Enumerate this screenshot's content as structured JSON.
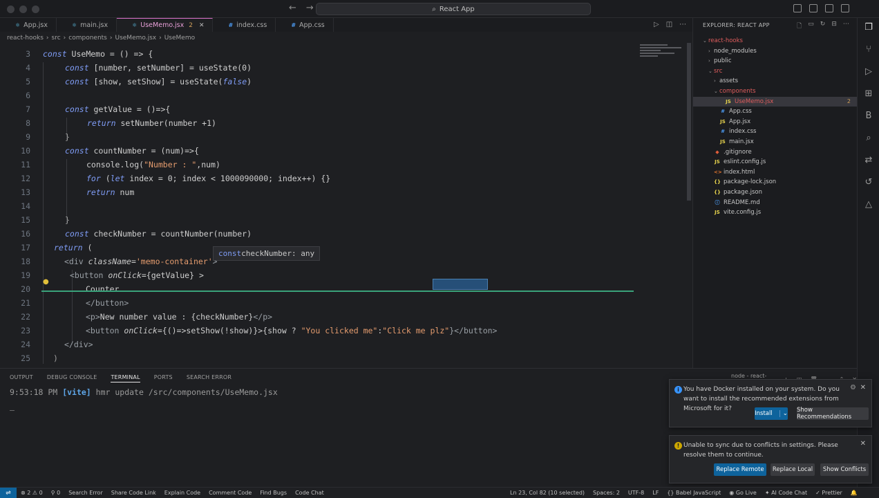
{
  "window": {
    "title": "React App"
  },
  "tabs": [
    {
      "label": "App.jsx",
      "icon": "⚛",
      "color": "#5ec2e8",
      "active": false
    },
    {
      "label": "main.jsx",
      "icon": "⚛",
      "color": "#5ec2e8",
      "active": false
    },
    {
      "label": "UseMemo.jsx",
      "badge": "2",
      "icon": "⚛",
      "color": "#5ec2e8",
      "active": true
    },
    {
      "label": "index.css",
      "icon": "#",
      "color": "#4c9bf2",
      "active": false
    },
    {
      "label": "App.css",
      "icon": "#",
      "color": "#4c9bf2",
      "active": false
    }
  ],
  "breadcrumb": [
    "react-hooks",
    "src",
    "components",
    "UseMemo.jsx",
    "UseMemo"
  ],
  "editor": {
    "line_numbers": [
      "3",
      "4",
      "5",
      "6",
      "7",
      "8",
      "9",
      "10",
      "11",
      "12",
      "13",
      "14",
      "15",
      "16",
      "17",
      "18",
      "19",
      "20",
      "21",
      "22",
      "23",
      "24",
      "25"
    ],
    "l3": {
      "kw": "const",
      "rest": " UseMemo = () => {"
    },
    "l4": {
      "kw": "const",
      "rest": " [number, setNumber] = useState(0)"
    },
    "l5": {
      "kw": "const",
      "rest": " [show, setShow] = useState(",
      "v": "false",
      "end": ")"
    },
    "l7": {
      "kw": "const",
      "rest": " getValue = ()=>{"
    },
    "l8": {
      "kw": "return",
      "rest": " setNumber(number +1)"
    },
    "l9": {
      "rest": "}"
    },
    "l10": {
      "kw": "const",
      "rest": " countNumber = (num)=>{"
    },
    "l11": {
      "a": "console.log(",
      "s": "\"Number : \"",
      "b": ",num)"
    },
    "l12": {
      "kw": "for",
      "a": " (",
      "kw2": "let",
      "b": " index = 0; index < 1000090000; index++) {}"
    },
    "l13": {
      "kw": "return",
      "rest": " num"
    },
    "l15": {
      "rest": "}"
    },
    "l16": {
      "kw": "const",
      "rest": " checkNumber = countNumber(number)"
    },
    "l17": {
      "kw": "return",
      "rest": " ("
    },
    "l18": {
      "a": "<div ",
      "attr": "className",
      "b": "=",
      "s": "'memo-container'",
      "c": ">"
    },
    "l19": {
      "a": "<button ",
      "attr": "onClick",
      "b": "={getValue} >"
    },
    "l20": {
      "rest": "Counter"
    },
    "l21": {
      "rest": "</button>"
    },
    "l22": {
      "a": "<p>",
      "b": "New number value : {checkNumber}",
      "c": "</p>"
    },
    "l23": {
      "a": "<button ",
      "attr": "onClick",
      "b": "={()=>setShow(!show)}>{show ? ",
      "s1": "\"You clicked me\"",
      "c": ":",
      "s2": "\"Click me plz\"",
      "d": "}</button>"
    },
    "l24": {
      "rest": "</div>"
    },
    "l25": {
      "rest": ")"
    },
    "hover": {
      "kw": "const",
      "text": " checkNumber: any"
    }
  },
  "panel": {
    "tabs": [
      "OUTPUT",
      "DEBUG CONSOLE",
      "TERMINAL",
      "PORTS",
      "SEARCH ERROR"
    ],
    "active_tab": "TERMINAL",
    "terminal_name": "node - react-hooks",
    "terminal_time": "9:53:18 PM",
    "terminal_tag": "[vite]",
    "terminal_msg": "hmr update /src/components/UseMemo.jsx",
    "terminal_cursor": "_"
  },
  "notifications": [
    {
      "message": "You have Docker installed on your system. Do you want to install the recommended extensions from Microsoft for it?",
      "buttons": [
        "Install",
        "Show Recommendations"
      ],
      "icon_color": "#3794ff"
    },
    {
      "message": "Unable to sync due to conflicts in settings. Please resolve them to continue.",
      "buttons": [
        "Replace Remote",
        "Replace Local",
        "Show Conflicts"
      ],
      "icon_color": "#cca700"
    }
  ],
  "explorer": {
    "title": "EXPLORER: REACT APP",
    "items": [
      {
        "label": "react-hooks",
        "indent": 0,
        "chev": "⌄",
        "type": "folder",
        "color": "#e05d5d"
      },
      {
        "label": "node_modules",
        "indent": 1,
        "chev": "›",
        "type": "folder",
        "color": "#c6c6c6"
      },
      {
        "label": "public",
        "indent": 1,
        "chev": "›",
        "type": "folder",
        "color": "#c6c6c6"
      },
      {
        "label": "src",
        "indent": 1,
        "chev": "⌄",
        "type": "folder",
        "color": "#e05d5d"
      },
      {
        "label": "assets",
        "indent": 2,
        "chev": "›",
        "type": "folder",
        "color": "#c6c6c6"
      },
      {
        "label": "components",
        "indent": 2,
        "chev": "⌄",
        "type": "folder",
        "color": "#e05d5d"
      },
      {
        "label": "UseMemo.jsx",
        "indent": 3,
        "chev": "",
        "type": "js",
        "color": "#e05d5d",
        "badge": "2",
        "selected": true
      },
      {
        "label": "App.css",
        "indent": 2,
        "chev": "",
        "type": "css",
        "color": "#c6c6c6"
      },
      {
        "label": "App.jsx",
        "indent": 2,
        "chev": "",
        "type": "js",
        "color": "#c6c6c6"
      },
      {
        "label": "index.css",
        "indent": 2,
        "chev": "",
        "type": "css",
        "color": "#c6c6c6"
      },
      {
        "label": "main.jsx",
        "indent": 2,
        "chev": "",
        "type": "js",
        "color": "#c6c6c6"
      },
      {
        "label": ".gitignore",
        "indent": 1,
        "chev": "",
        "type": "git",
        "color": "#c6c6c6"
      },
      {
        "label": "eslint.config.js",
        "indent": 1,
        "chev": "",
        "type": "js",
        "color": "#c6c6c6"
      },
      {
        "label": "index.html",
        "indent": 1,
        "chev": "",
        "type": "html",
        "color": "#c6c6c6"
      },
      {
        "label": "package-lock.json",
        "indent": 1,
        "chev": "",
        "type": "json",
        "color": "#c6c6c6"
      },
      {
        "label": "package.json",
        "indent": 1,
        "chev": "",
        "type": "json",
        "color": "#c6c6c6"
      },
      {
        "label": "README.md",
        "indent": 1,
        "chev": "",
        "type": "info",
        "color": "#c6c6c6"
      },
      {
        "label": "vite.config.js",
        "indent": 1,
        "chev": "",
        "type": "js",
        "color": "#c6c6c6"
      }
    ]
  },
  "statusbar": {
    "problems_errors": "2",
    "problems_warnings": "0",
    "ports": "0",
    "left_items": [
      "Search Error",
      "Share Code Link",
      "Explain Code",
      "Comment Code",
      "Find Bugs",
      "Code Chat"
    ],
    "right_items": [
      "Ln 23, Col 82 (10 selected)",
      "Spaces: 2",
      "UTF-8",
      "LF",
      "{} Babel JavaScript",
      "Go Live",
      "AI Code Chat",
      "Prettier"
    ]
  }
}
